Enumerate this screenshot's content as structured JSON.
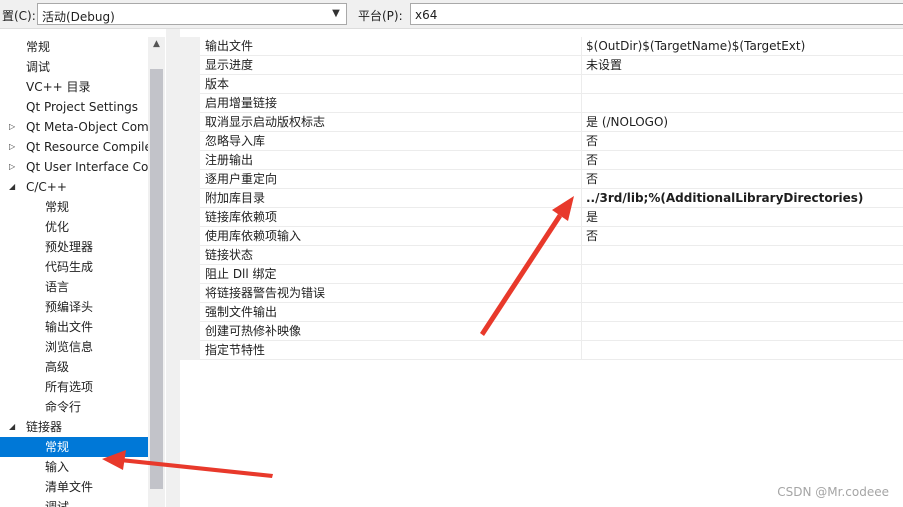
{
  "topbar": {
    "config_label": "置(C):",
    "config_value": "活动(Debug)",
    "platform_label": "平台(P):",
    "platform_value": "x64"
  },
  "tree": {
    "items": [
      {
        "label": "常规",
        "indent": 0,
        "expander": ""
      },
      {
        "label": "调试",
        "indent": 0,
        "expander": ""
      },
      {
        "label": "VC++ 目录",
        "indent": 0,
        "expander": ""
      },
      {
        "label": "Qt Project Settings",
        "indent": 0,
        "expander": ""
      },
      {
        "label": "Qt Meta-Object Com",
        "indent": 0,
        "expander": "▷"
      },
      {
        "label": "Qt Resource Compile",
        "indent": 0,
        "expander": "▷"
      },
      {
        "label": "Qt User Interface Co",
        "indent": 0,
        "expander": "▷"
      },
      {
        "label": "C/C++",
        "indent": 0,
        "expander": "◢"
      },
      {
        "label": "常规",
        "indent": 1,
        "expander": ""
      },
      {
        "label": "优化",
        "indent": 1,
        "expander": ""
      },
      {
        "label": "预处理器",
        "indent": 1,
        "expander": ""
      },
      {
        "label": "代码生成",
        "indent": 1,
        "expander": ""
      },
      {
        "label": "语言",
        "indent": 1,
        "expander": ""
      },
      {
        "label": "预编译头",
        "indent": 1,
        "expander": ""
      },
      {
        "label": "输出文件",
        "indent": 1,
        "expander": ""
      },
      {
        "label": "浏览信息",
        "indent": 1,
        "expander": ""
      },
      {
        "label": "高级",
        "indent": 1,
        "expander": ""
      },
      {
        "label": "所有选项",
        "indent": 1,
        "expander": ""
      },
      {
        "label": "命令行",
        "indent": 1,
        "expander": ""
      },
      {
        "label": "链接器",
        "indent": 0,
        "expander": "◢"
      },
      {
        "label": "常规",
        "indent": 1,
        "expander": "",
        "selected": true
      },
      {
        "label": "输入",
        "indent": 1,
        "expander": ""
      },
      {
        "label": "清单文件",
        "indent": 1,
        "expander": ""
      },
      {
        "label": "调试",
        "indent": 1,
        "expander": ""
      }
    ]
  },
  "grid": {
    "rows": [
      {
        "name": "输出文件",
        "value": "$(OutDir)$(TargetName)$(TargetExt)"
      },
      {
        "name": "显示进度",
        "value": "未设置"
      },
      {
        "name": "版本",
        "value": ""
      },
      {
        "name": "启用增量链接",
        "value": ""
      },
      {
        "name": "取消显示启动版权标志",
        "value": "是 (/NOLOGO)"
      },
      {
        "name": "忽略导入库",
        "value": "否"
      },
      {
        "name": "注册输出",
        "value": "否"
      },
      {
        "name": "逐用户重定向",
        "value": "否"
      },
      {
        "name": "附加库目录",
        "value": "../3rd/lib;%(AdditionalLibraryDirectories)",
        "bold": true
      },
      {
        "name": "链接库依赖项",
        "value": "是"
      },
      {
        "name": "使用库依赖项输入",
        "value": "否"
      },
      {
        "name": "链接状态",
        "value": ""
      },
      {
        "name": "阻止 Dll 绑定",
        "value": ""
      },
      {
        "name": "将链接器警告视为错误",
        "value": ""
      },
      {
        "name": "强制文件输出",
        "value": ""
      },
      {
        "name": "创建可热修补映像",
        "value": ""
      },
      {
        "name": "指定节特性",
        "value": ""
      }
    ]
  },
  "watermark": "CSDN @Mr.codeee",
  "colors": {
    "selection": "#0078d7",
    "annotation_arrow": "#e8392b"
  }
}
